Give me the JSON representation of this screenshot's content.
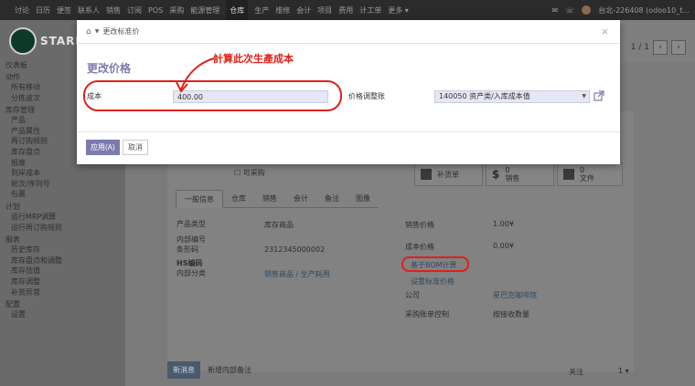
{
  "topbar": {
    "menus": [
      "讨论",
      "日历",
      "便签",
      "联系人",
      "销售",
      "订阅",
      "POS",
      "采购",
      "能源管理",
      "仓库",
      "生产",
      "维修",
      "会计",
      "项目",
      "费用",
      "计工单",
      "更多 ▾"
    ],
    "active_index": 9,
    "user": "台北-226408 (odoo10_t..."
  },
  "sidebar": {
    "logo_text": "STARE",
    "sections": [
      {
        "title": "仪表板",
        "items": []
      },
      {
        "title": "动作",
        "items": [
          "所有移动",
          "分拣波次"
        ]
      },
      {
        "title": "库存管理",
        "items": [
          "产品",
          "产品属性",
          "再订购规则",
          "库存盘点",
          "报废",
          "到岸成本",
          "批次/序列号",
          "包裹"
        ]
      },
      {
        "title": "计划",
        "items": [
          "运行MRP调算",
          "运行再订购规则"
        ]
      },
      {
        "title": "报表",
        "items": [
          "历史库存",
          "库存盘点和调整",
          "库存估值",
          "库存调整",
          "补货异常"
        ]
      },
      {
        "title": "配置",
        "items": [
          "设置"
        ]
      }
    ]
  },
  "background": {
    "pager": "1 / 1",
    "can_purchase": "可采购",
    "stat_buttons": [
      "补货单",
      "0\n销售",
      "0\n文件"
    ],
    "tabs": [
      "一般信息",
      "仓库",
      "销售",
      "会计",
      "备注",
      "图像"
    ],
    "left_fields": [
      {
        "label": "产品类型",
        "value": "库存商品"
      },
      {
        "label": "内部编号",
        "value": ""
      },
      {
        "label": "条形码",
        "value": "2312345000002"
      },
      {
        "label": "HS编码",
        "value": ""
      },
      {
        "label": "内部分类",
        "value": "销售商品 / 生产耗用"
      }
    ],
    "right_fields": [
      {
        "label": "销售价格",
        "value": "1.00¥"
      },
      {
        "label": "成本价格",
        "value": "0.00¥"
      },
      {
        "label": "公司",
        "value": "星巴克咖啡馆"
      },
      {
        "label": "采购账单控制",
        "value": "按接收数量"
      }
    ],
    "bom_link": "基于BOM计算",
    "set_std_link": "设置标准价格",
    "chatter": {
      "new_message": "新消息",
      "log_note": "新增内部备注",
      "follow": "关注",
      "followers": "1 ▾"
    }
  },
  "modal": {
    "breadcrumb": "更改标准价",
    "title": "更改价格",
    "cost_label": "成本",
    "cost_value": "400.00",
    "account_label": "价格调整账",
    "account_value": "140050 资产类/入库成本值",
    "apply_label": "应用(A)",
    "cancel_label": "取消",
    "close_glyph": "×"
  },
  "annotation": {
    "text": "計算此次生產成本",
    "color": "#e0201a"
  }
}
